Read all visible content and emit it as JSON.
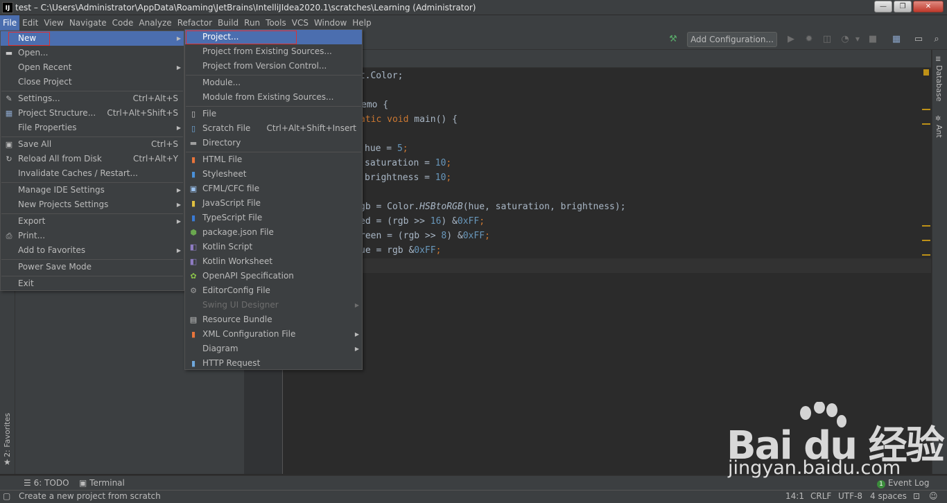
{
  "window": {
    "title": "test – C:\\Users\\Administrator\\AppData\\Roaming\\JetBrains\\IntelliJIdea2020.1\\scratches\\Learning (Administrator)",
    "logo": "IJ",
    "min": "—",
    "max": "❐",
    "close": "✕"
  },
  "menubar": [
    "File",
    "Edit",
    "View",
    "Navigate",
    "Code",
    "Analyze",
    "Refactor",
    "Build",
    "Run",
    "Tools",
    "VCS",
    "Window",
    "Help"
  ],
  "toolbar": {
    "add_configuration": "Add Configuration..."
  },
  "file_menu": {
    "items": [
      {
        "label": "New",
        "submenu": true,
        "icon": ""
      },
      {
        "label": "Open...",
        "icon": "folder-icon"
      },
      {
        "label": "Open Recent",
        "submenu": true
      },
      {
        "label": "Close Project"
      },
      {
        "label": "Settings...",
        "shortcut": "Ctrl+Alt+S",
        "icon": "wrench-icon"
      },
      {
        "label": "Project Structure...",
        "shortcut": "Ctrl+Alt+Shift+S",
        "icon": "project-structure-icon"
      },
      {
        "label": "File Properties",
        "submenu": true
      },
      {
        "label": "Save All",
        "shortcut": "Ctrl+S",
        "icon": "save-icon"
      },
      {
        "label": "Reload All from Disk",
        "shortcut": "Ctrl+Alt+Y",
        "icon": "reload-icon"
      },
      {
        "label": "Invalidate Caches / Restart..."
      },
      {
        "label": "Manage IDE Settings",
        "submenu": true
      },
      {
        "label": "New Projects Settings",
        "submenu": true
      },
      {
        "label": "Export",
        "submenu": true
      },
      {
        "label": "Print...",
        "icon": "print-icon"
      },
      {
        "label": "Add to Favorites",
        "submenu": true
      },
      {
        "label": "Power Save Mode"
      },
      {
        "label": "Exit"
      }
    ]
  },
  "new_menu": {
    "items": [
      {
        "label": "Project..."
      },
      {
        "label": "Project from Existing Sources..."
      },
      {
        "label": "Project from Version Control..."
      },
      {
        "label": "Module..."
      },
      {
        "label": "Module from Existing Sources..."
      },
      {
        "label": "File",
        "icon": "file-icon"
      },
      {
        "label": "Scratch File",
        "shortcut": "Ctrl+Alt+Shift+Insert",
        "icon": "scratch-file-icon"
      },
      {
        "label": "Directory",
        "icon": "directory-icon"
      },
      {
        "label": "HTML File",
        "icon": "html-icon"
      },
      {
        "label": "Stylesheet",
        "icon": "css-icon"
      },
      {
        "label": "CFML/CFC file",
        "icon": "cfml-icon"
      },
      {
        "label": "JavaScript File",
        "icon": "javascript-icon"
      },
      {
        "label": "TypeScript File",
        "icon": "typescript-icon"
      },
      {
        "label": "package.json File",
        "icon": "nodejs-icon"
      },
      {
        "label": "Kotlin Script",
        "icon": "kotlin-icon"
      },
      {
        "label": "Kotlin Worksheet",
        "icon": "kotlin-icon"
      },
      {
        "label": "OpenAPI Specification",
        "icon": "openapi-icon"
      },
      {
        "label": "EditorConfig File",
        "icon": "gear-icon"
      },
      {
        "label": "Swing UI Designer",
        "submenu": true,
        "disabled": true
      },
      {
        "label": "Resource Bundle",
        "icon": "resource-bundle-icon"
      },
      {
        "label": "XML Configuration File",
        "submenu": true,
        "icon": "xml-icon"
      },
      {
        "label": "Diagram",
        "submenu": true
      },
      {
        "label": "HTTP Request",
        "icon": "http-request-icon"
      }
    ]
  },
  "code": {
    "line1": "ut.Color;",
    "line2": "emo {",
    "line3a": "atic void ",
    "line3b": "main() {",
    "line4": "hue = ",
    "line4n": "5",
    "line5": "saturation = ",
    "line5n": "10",
    "line6": "brightness = ",
    "line6n": "10",
    "line7a": "gb = Color.",
    "line7b": "HSBtoRGB",
    "line7c": "(hue, saturation, brightness);",
    "line8a": "ed = (rgb >> ",
    "line8n": "16",
    "line8b": ") &",
    "line8h": "0xFF",
    "line9a": "reen = (rgb >> ",
    "line9n": "8",
    "line9b": ") &",
    "line9h": "0xFF",
    "line10a": "ue = rgb &",
    "line10h": "0xFF",
    "semi": ";"
  },
  "side_tabs": {
    "database": "Database",
    "ant": "Ant",
    "favorites": "2: Favorites"
  },
  "bottom_tabs": {
    "todo": "6: TODO",
    "terminal": "Terminal",
    "event_log": "Event Log",
    "event_count": "1"
  },
  "status": {
    "message": "Create a new project from scratch",
    "position": "14:1",
    "line_sep": "CRLF",
    "encoding": "UTF-8",
    "indent": "4 spaces"
  },
  "watermark": {
    "brand": "Bai du 经验",
    "url": "jingyan.baidu.com"
  }
}
